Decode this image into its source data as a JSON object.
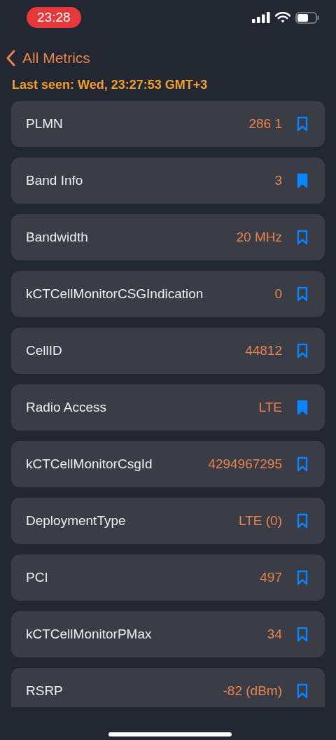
{
  "status_bar": {
    "time": "23:28"
  },
  "nav": {
    "back_label": "All Metrics"
  },
  "last_seen": "Last seen: Wed, 23:27:53 GMT+3",
  "metrics": [
    {
      "name": "PLMN",
      "value": "286 1",
      "bookmarked": false
    },
    {
      "name": "Band Info",
      "value": "3",
      "bookmarked": true
    },
    {
      "name": "Bandwidth",
      "value": "20 MHz",
      "bookmarked": false
    },
    {
      "name": "kCTCellMonitorCSGIndication",
      "value": "0",
      "bookmarked": false
    },
    {
      "name": "CellID",
      "value": "44812",
      "bookmarked": false
    },
    {
      "name": "Radio Access",
      "value": "LTE",
      "bookmarked": true
    },
    {
      "name": "kCTCellMonitorCsgId",
      "value": "4294967295",
      "bookmarked": false
    },
    {
      "name": "DeploymentType",
      "value": "LTE (0)",
      "bookmarked": false
    },
    {
      "name": "PCI",
      "value": "497",
      "bookmarked": false
    },
    {
      "name": "kCTCellMonitorPMax",
      "value": "34",
      "bookmarked": false
    },
    {
      "name": "RSRP",
      "value": "-82 (dBm)",
      "bookmarked": false
    }
  ]
}
